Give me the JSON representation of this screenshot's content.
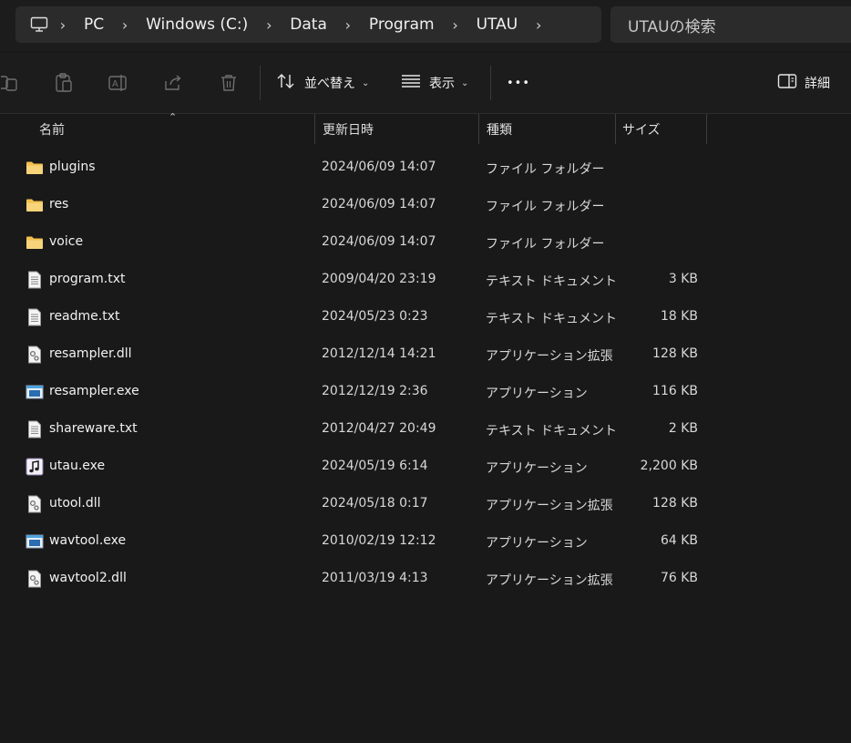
{
  "address": {
    "icon": "computer-icon",
    "crumbs": [
      "PC",
      "Windows (C:)",
      "Data",
      "Program",
      "UTAU"
    ],
    "search_placeholder": "UTAUの検索"
  },
  "toolbar": {
    "sort_label": "並べ替え",
    "view_label": "表示",
    "more_label": "•••",
    "details_label": "詳細"
  },
  "columns": {
    "name": "名前",
    "modified": "更新日時",
    "type": "種類",
    "size": "サイズ"
  },
  "colors": {
    "folder": "#f2c14e",
    "background": "#191919",
    "accent": "#4fa3e0"
  },
  "files": [
    {
      "name": "plugins",
      "modified": "2024/06/09 14:07",
      "type": "ファイル フォルダー",
      "size": "",
      "icon": "folder-icon"
    },
    {
      "name": "res",
      "modified": "2024/06/09 14:07",
      "type": "ファイル フォルダー",
      "size": "",
      "icon": "folder-icon"
    },
    {
      "name": "voice",
      "modified": "2024/06/09 14:07",
      "type": "ファイル フォルダー",
      "size": "",
      "icon": "folder-icon"
    },
    {
      "name": "program.txt",
      "modified": "2009/04/20 23:19",
      "type": "テキスト ドキュメント",
      "size": "3 KB",
      "icon": "text-file-icon"
    },
    {
      "name": "readme.txt",
      "modified": "2024/05/23 0:23",
      "type": "テキスト ドキュメント",
      "size": "18 KB",
      "icon": "text-file-icon"
    },
    {
      "name": "resampler.dll",
      "modified": "2012/12/14 14:21",
      "type": "アプリケーション拡張",
      "size": "128 KB",
      "icon": "dll-file-icon"
    },
    {
      "name": "resampler.exe",
      "modified": "2012/12/19 2:36",
      "type": "アプリケーション",
      "size": "116 KB",
      "icon": "exe-window-icon"
    },
    {
      "name": "shareware.txt",
      "modified": "2012/04/27 20:49",
      "type": "テキスト ドキュメント",
      "size": "2 KB",
      "icon": "text-file-icon"
    },
    {
      "name": "utau.exe",
      "modified": "2024/05/19 6:14",
      "type": "アプリケーション",
      "size": "2,200 KB",
      "icon": "music-note-app-icon"
    },
    {
      "name": "utool.dll",
      "modified": "2024/05/18 0:17",
      "type": "アプリケーション拡張",
      "size": "128 KB",
      "icon": "dll-file-icon"
    },
    {
      "name": "wavtool.exe",
      "modified": "2010/02/19 12:12",
      "type": "アプリケーション",
      "size": "64 KB",
      "icon": "exe-window-icon"
    },
    {
      "name": "wavtool2.dll",
      "modified": "2011/03/19 4:13",
      "type": "アプリケーション拡張",
      "size": "76 KB",
      "icon": "dll-file-icon"
    }
  ]
}
